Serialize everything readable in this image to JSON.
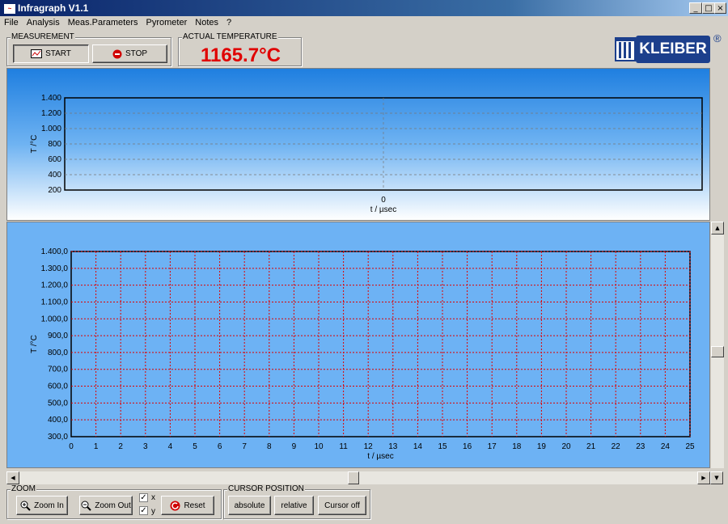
{
  "window": {
    "title": "Infragraph V1.1",
    "min": "_",
    "max": "□",
    "close": "×"
  },
  "menu": [
    "File",
    "Analysis",
    "Meas.Parameters",
    "Pyrometer",
    "Notes",
    "?"
  ],
  "measurement": {
    "label": "MEASUREMENT",
    "start": "START",
    "stop": "STOP"
  },
  "actual_temperature": {
    "label": "ACTUAL TEMPERATURE",
    "value": "1165.7°C"
  },
  "logo": {
    "text": "KLEIBER",
    "mark": "®"
  },
  "chart_data": [
    {
      "type": "line",
      "ylabel": "T /°C",
      "xlabel": "t / µsec",
      "y_ticks": [
        "1.400",
        "1.200",
        "1.000",
        "800",
        "600",
        "400",
        "200"
      ],
      "x_ticks": [
        "0"
      ],
      "ylim": [
        200,
        1400
      ],
      "series": []
    },
    {
      "type": "line",
      "ylabel": "T /°C",
      "xlabel": "t / µsec",
      "y_ticks": [
        "1.400,0",
        "1.300,0",
        "1.200,0",
        "1.100,0",
        "1.000,0",
        "900,0",
        "800,0",
        "700,0",
        "600,0",
        "500,0",
        "400,0",
        "300,0"
      ],
      "x_ticks": [
        "0",
        "1",
        "2",
        "3",
        "4",
        "5",
        "6",
        "7",
        "8",
        "9",
        "10",
        "11",
        "12",
        "13",
        "14",
        "15",
        "16",
        "17",
        "18",
        "19",
        "20",
        "21",
        "22",
        "23",
        "24",
        "25"
      ],
      "xlim": [
        0,
        25
      ],
      "ylim": [
        300,
        1400
      ],
      "grid": true,
      "series": []
    }
  ],
  "zoom": {
    "label": "ZOOM",
    "zoom_in": "Zoom In",
    "zoom_out": "Zoom Out",
    "x_label": "x",
    "y_label": "y",
    "x_checked": "✓",
    "y_checked": "✓",
    "reset": "Reset"
  },
  "cursor": {
    "label": "CURSOR POSITION",
    "absolute": "absolute",
    "relative": "relative",
    "off": "Cursor off"
  },
  "colors": {
    "title_bar": "#0a246a",
    "temperature": "#e00000",
    "grid": "#e00000",
    "chart_bg": "#6db2f4",
    "logo_bg": "#1c3f8c"
  }
}
